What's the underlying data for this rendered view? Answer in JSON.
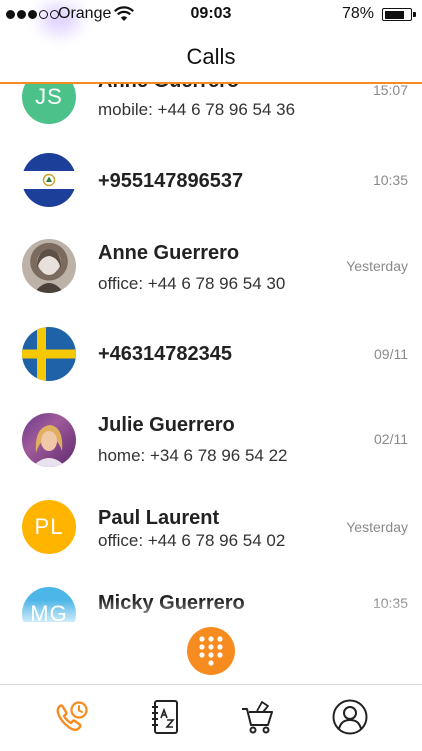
{
  "status_bar": {
    "carrier": "Orange",
    "time": "09:03",
    "battery_percent": "78%"
  },
  "header": {
    "title": "Calls"
  },
  "accent_color": "#f68b1f",
  "calls": [
    {
      "initials": "JS",
      "avatar_color": "#4cc28a",
      "name": "Anne Guerrero",
      "detail": "mobile: +44 6 78 96 54 36",
      "time": "15:07"
    },
    {
      "avatar_flag": "El Salvador flag",
      "name": "+955147896537",
      "detail": "",
      "time": "10:35"
    },
    {
      "avatar_photo": "woman portrait",
      "name": "Anne Guerrero",
      "detail": "office: +44 6 78 96 54 30",
      "time": "Yesterday"
    },
    {
      "avatar_flag": "Sweden flag",
      "name": "+46314782345",
      "detail": "",
      "time": "09/11"
    },
    {
      "avatar_photo": "woman portrait",
      "name": "Julie Guerrero",
      "detail": "home: +34 6 78 96 54 22",
      "time": "02/11"
    },
    {
      "initials": "PL",
      "avatar_color": "#ffb400",
      "name": "Paul Laurent",
      "detail": "office: +44 6 78 96 54 02",
      "time": "Yesterday"
    },
    {
      "initials": "MG",
      "avatar_color": "#4db6e8",
      "name": "Micky Guerrero",
      "detail": "",
      "time": "10:35"
    }
  ],
  "tab_bar": {
    "tabs": [
      {
        "icon": "recent-calls-icon",
        "active": true
      },
      {
        "icon": "contacts-az-icon",
        "active": false
      },
      {
        "icon": "shopping-cart-icon",
        "active": false
      },
      {
        "icon": "profile-icon",
        "active": false
      }
    ]
  }
}
